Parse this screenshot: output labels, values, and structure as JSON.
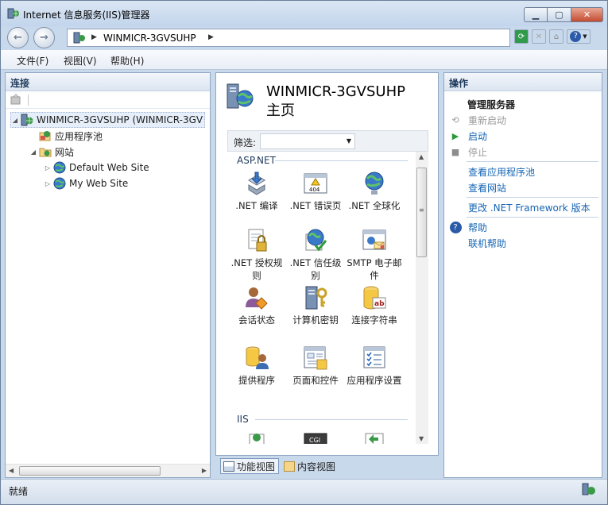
{
  "window": {
    "title": "Internet 信息服务(IIS)管理器"
  },
  "address": {
    "path": "WINMICR-3GVSUHP"
  },
  "menu": [
    "文件(F)",
    "视图(V)",
    "帮助(H)"
  ],
  "connections": {
    "header": "连接",
    "tree": [
      {
        "label": "WINMICR-3GVSUHP (WINMICR-3GV",
        "level": 0,
        "expander": "◢",
        "icon": "server-icon"
      },
      {
        "label": "应用程序池",
        "level": 1,
        "expander": "",
        "icon": "app-pool-icon"
      },
      {
        "label": "网站",
        "level": 1,
        "expander": "◢",
        "icon": "sites-folder-icon"
      },
      {
        "label": "Default Web Site",
        "level": 2,
        "expander": "▷",
        "icon": "website-globe-icon"
      },
      {
        "label": "My Web Site",
        "level": 2,
        "expander": "▷",
        "icon": "website-globe-icon"
      }
    ]
  },
  "center": {
    "title_line1": "WINMICR-3GVSUHP",
    "title_line2": "主页",
    "filter_label": "筛选:",
    "groups": [
      {
        "name": "ASP.NET",
        "features": [
          {
            "label": ".NET 编译",
            "icon": "net-compilation-icon"
          },
          {
            "label": ".NET 错误页",
            "icon": "net-error-pages-icon"
          },
          {
            "label": ".NET 全球化",
            "icon": "net-globalization-icon"
          },
          {
            "label": ".NET 授权规则",
            "icon": "net-authorization-icon"
          },
          {
            "label": ".NET 信任级别",
            "icon": "net-trust-levels-icon"
          },
          {
            "label": "SMTP 电子邮件",
            "icon": "smtp-email-icon"
          },
          {
            "label": "会话状态",
            "icon": "session-state-icon"
          },
          {
            "label": "计算机密钥",
            "icon": "machine-key-icon"
          },
          {
            "label": "连接字符串",
            "icon": "connection-strings-icon"
          },
          {
            "label": "提供程序",
            "icon": "providers-icon"
          },
          {
            "label": "页面和控件",
            "icon": "pages-controls-icon"
          },
          {
            "label": "应用程序设置",
            "icon": "app-settings-icon"
          }
        ]
      },
      {
        "name": "IIS",
        "features": []
      }
    ],
    "view_tabs": [
      "功能视图",
      "内容视图"
    ]
  },
  "actions": {
    "header": "操作",
    "section_title": "管理服务器",
    "items": [
      {
        "label": "重新启动",
        "state": "disabled",
        "icon": "restart-icon"
      },
      {
        "label": "启动",
        "state": "link",
        "icon": "start-icon"
      },
      {
        "label": "停止",
        "state": "disabled",
        "icon": "stop-icon"
      },
      {
        "label": "查看应用程序池",
        "state": "link",
        "icon": ""
      },
      {
        "label": "查看网站",
        "state": "link",
        "icon": ""
      },
      {
        "label": "更改 .NET Framework 版本",
        "state": "link",
        "icon": ""
      },
      {
        "label": "帮助",
        "state": "link",
        "icon": "help-icon"
      },
      {
        "label": "联机帮助",
        "state": "link",
        "icon": ""
      }
    ]
  },
  "status": {
    "text": "就绪"
  },
  "colors": {
    "link": "#1565b4",
    "pane_border": "#8fa6c4",
    "header_text": "#1e395b"
  }
}
